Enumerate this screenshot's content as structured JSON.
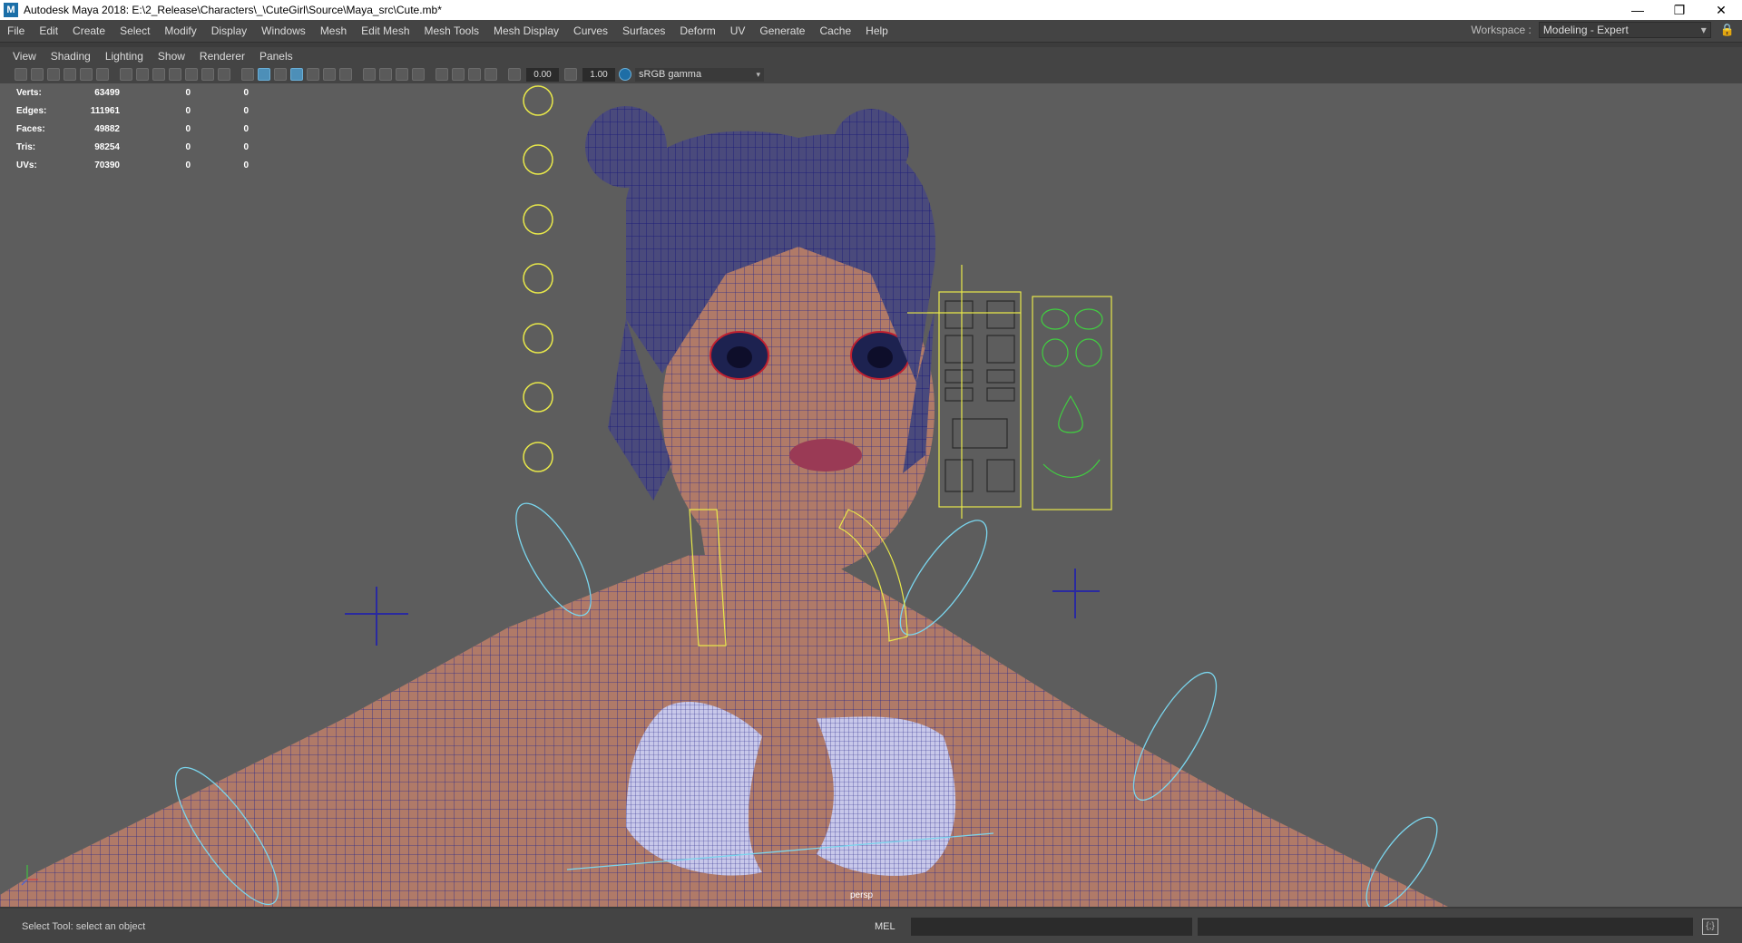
{
  "window": {
    "title": "Autodesk Maya 2018: E:\\2_Release\\Characters\\_\\CuteGirl\\Source\\Maya_src\\Cute.mb*",
    "app_icon": "M",
    "minimize": "—",
    "maximize": "❐",
    "close": "✕"
  },
  "menubar": {
    "items": [
      "File",
      "Edit",
      "Create",
      "Select",
      "Modify",
      "Display",
      "Windows",
      "Mesh",
      "Edit Mesh",
      "Mesh Tools",
      "Mesh Display",
      "Curves",
      "Surfaces",
      "Deform",
      "UV",
      "Generate",
      "Cache",
      "Help"
    ]
  },
  "workspace": {
    "label": "Workspace :",
    "value": "Modeling - Expert",
    "arrow": "▾",
    "lock": "🔒"
  },
  "panel_menu": {
    "items": [
      "View",
      "Shading",
      "Lighting",
      "Show",
      "Renderer",
      "Panels"
    ]
  },
  "toolbar": {
    "exposure": "0.00",
    "gamma": "1.00",
    "color_space": "sRGB gamma",
    "arrow": "▾"
  },
  "hud": {
    "rows": [
      {
        "label": "Verts:",
        "total": "63499",
        "selected": "0",
        "component": "0"
      },
      {
        "label": "Edges:",
        "total": "111961",
        "selected": "0",
        "component": "0"
      },
      {
        "label": "Faces:",
        "total": "49882",
        "selected": "0",
        "component": "0"
      },
      {
        "label": "Tris:",
        "total": "98254",
        "selected": "0",
        "component": "0"
      },
      {
        "label": "UVs:",
        "total": "70390",
        "selected": "0",
        "component": "0"
      }
    ]
  },
  "viewport": {
    "camera": "persp",
    "background_color": "#5d5d5d",
    "mesh_color": "#b07a68",
    "wire_color": "#2a2a8a",
    "control_yellow": "#e8e84a",
    "control_cyan": "#7ad6ee",
    "control_green": "#40d040"
  },
  "status": {
    "help_line": "Select Tool: select an object",
    "mel_label": "MEL",
    "script_editor_icon": "{;}"
  }
}
